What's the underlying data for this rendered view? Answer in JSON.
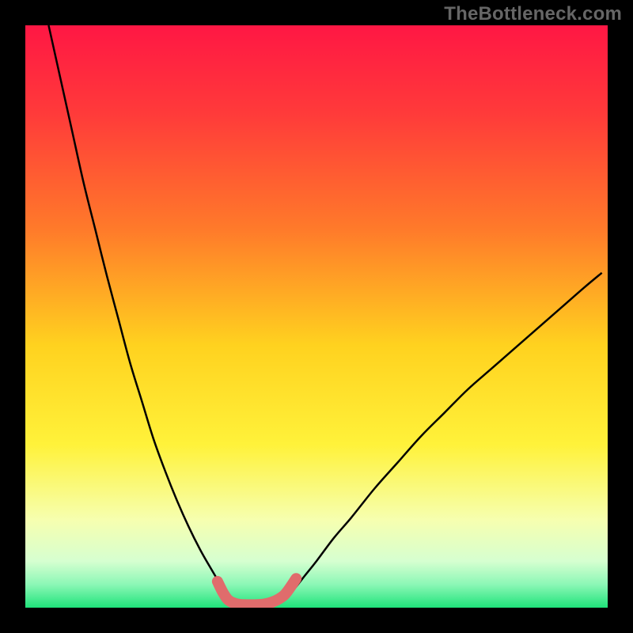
{
  "watermark": "TheBottleneck.com",
  "chart_data": {
    "type": "line",
    "title": "",
    "xlabel": "",
    "ylabel": "",
    "xlim": [
      0,
      100
    ],
    "ylim": [
      0,
      100
    ],
    "grid": false,
    "legend": false,
    "background_gradient_stops": [
      {
        "offset": 0.0,
        "color": "#ff1744"
      },
      {
        "offset": 0.15,
        "color": "#ff3a3a"
      },
      {
        "offset": 0.35,
        "color": "#ff7a2a"
      },
      {
        "offset": 0.55,
        "color": "#ffd21f"
      },
      {
        "offset": 0.72,
        "color": "#fff23a"
      },
      {
        "offset": 0.85,
        "color": "#f6ffb0"
      },
      {
        "offset": 0.92,
        "color": "#d6ffd0"
      },
      {
        "offset": 0.96,
        "color": "#8cf7b6"
      },
      {
        "offset": 1.0,
        "color": "#1fe37a"
      }
    ],
    "series": [
      {
        "name": "bottleneck-curve-left",
        "stroke": "#000000",
        "stroke_width": 2.5,
        "x": [
          4,
          6,
          8,
          10,
          12,
          14,
          16,
          18,
          20,
          22,
          24,
          26,
          28,
          30,
          32,
          33.5,
          34.5,
          35.2
        ],
        "y": [
          100,
          91,
          82,
          73,
          65,
          57,
          49.5,
          42,
          35.5,
          29,
          23.5,
          18.5,
          14,
          10,
          6.5,
          4,
          2.5,
          1.5
        ]
      },
      {
        "name": "bottleneck-curve-right",
        "stroke": "#000000",
        "stroke_width": 2.5,
        "x": [
          44.5,
          46,
          48,
          50,
          53,
          56,
          60,
          64,
          68,
          72,
          76,
          80,
          84,
          88,
          92,
          96,
          99
        ],
        "y": [
          1.5,
          3,
          5.5,
          8,
          12,
          15.5,
          20.5,
          25,
          29.5,
          33.5,
          37.5,
          41,
          44.5,
          48,
          51.5,
          55,
          57.5
        ]
      },
      {
        "name": "flat-bottom-marker",
        "stroke": "#e06c6c",
        "stroke_width": 14,
        "linecap": "round",
        "x": [
          33,
          34,
          35,
          36.5,
          38,
          39.5,
          41,
          42.5,
          44,
          45,
          46.5
        ],
        "y": [
          4.5,
          2.5,
          1.2,
          0.6,
          0.5,
          0.5,
          0.6,
          1.0,
          1.8,
          2.8,
          5.0
        ]
      }
    ],
    "annotations": []
  }
}
